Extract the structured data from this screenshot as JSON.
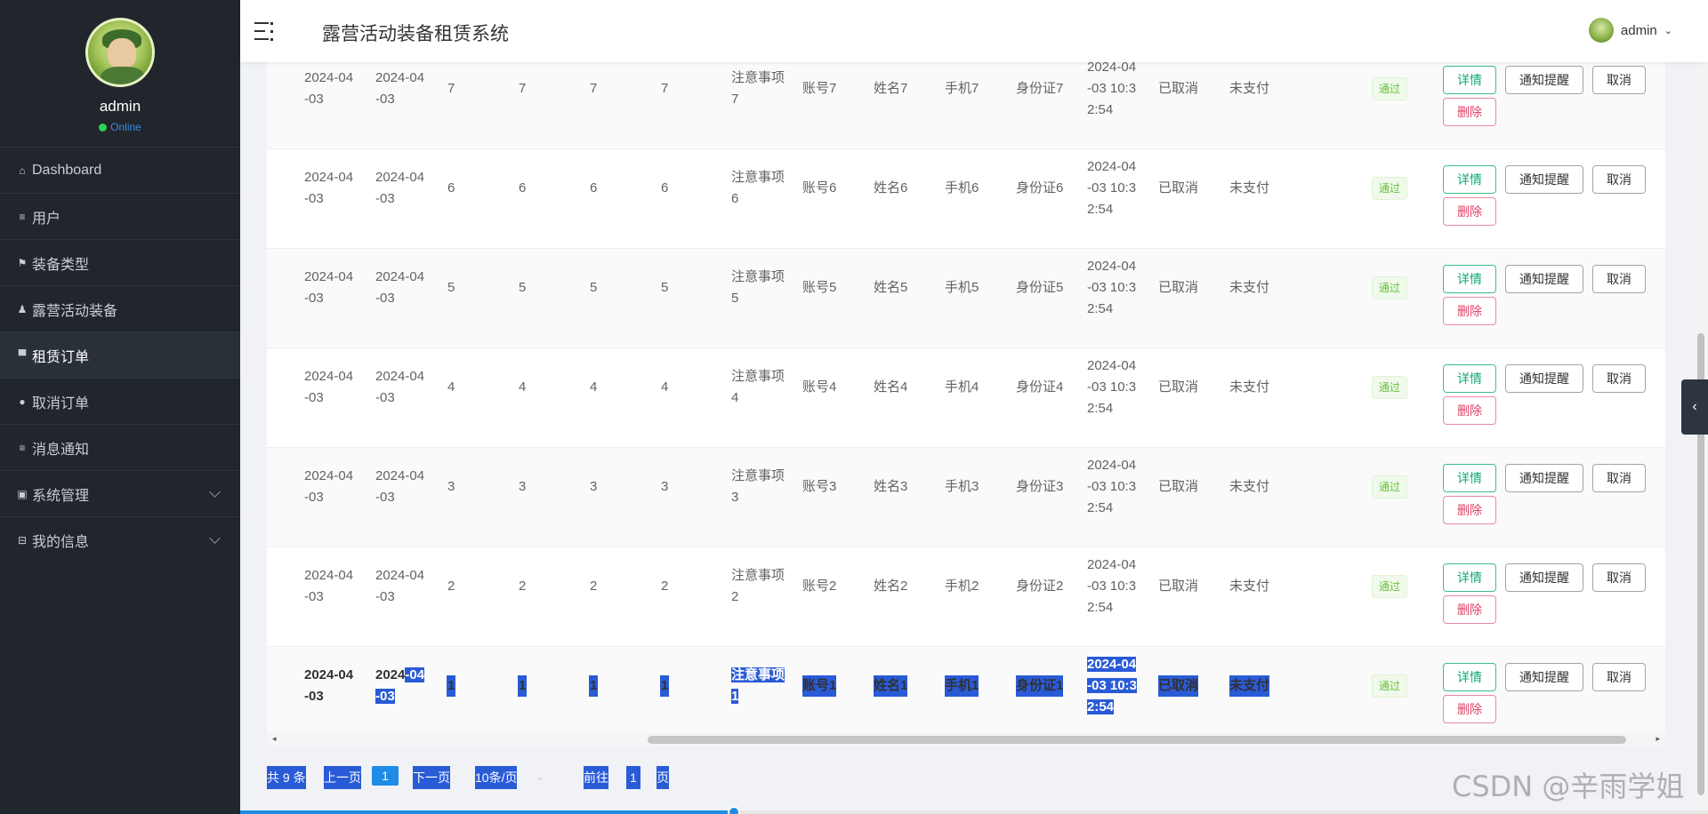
{
  "sidebar": {
    "username": "admin",
    "status": "Online",
    "items": [
      {
        "icon": "⌂",
        "label": "Dashboard"
      },
      {
        "icon": "≡",
        "label": "用户"
      },
      {
        "icon": "⚑",
        "label": "装备类型"
      },
      {
        "icon": "♟",
        "label": "露营活动装备"
      },
      {
        "icon": "▀",
        "label": "租赁订单",
        "active": true
      },
      {
        "icon": "●",
        "label": "取消订单"
      },
      {
        "icon": "≡",
        "label": "消息通知"
      },
      {
        "icon": "▣",
        "label": "系统管理",
        "expandable": true
      },
      {
        "icon": "⊟",
        "label": "我的信息",
        "expandable": true
      }
    ]
  },
  "header": {
    "title": "露营活动装备租赁系统",
    "user": "admin"
  },
  "table": {
    "rows": [
      {
        "start": "2024-04-03",
        "end": "2024-04-03",
        "c1": "7",
        "c2": "7",
        "c3": "7",
        "c4": "7",
        "notes": "注意事项7",
        "account": "账号7",
        "name": "姓名7",
        "phone": "手机7",
        "idcard": "身份证7",
        "time": "2024-04-03 10:32:54",
        "status": "已取消",
        "pay": "未支付",
        "review": "通过"
      },
      {
        "start": "2024-04-03",
        "end": "2024-04-03",
        "c1": "6",
        "c2": "6",
        "c3": "6",
        "c4": "6",
        "notes": "注意事项6",
        "account": "账号6",
        "name": "姓名6",
        "phone": "手机6",
        "idcard": "身份证6",
        "time": "2024-04-03 10:32:54",
        "status": "已取消",
        "pay": "未支付",
        "review": "通过"
      },
      {
        "start": "2024-04-03",
        "end": "2024-04-03",
        "c1": "5",
        "c2": "5",
        "c3": "5",
        "c4": "5",
        "notes": "注意事项5",
        "account": "账号5",
        "name": "姓名5",
        "phone": "手机5",
        "idcard": "身份证5",
        "time": "2024-04-03 10:32:54",
        "status": "已取消",
        "pay": "未支付",
        "review": "通过"
      },
      {
        "start": "2024-04-03",
        "end": "2024-04-03",
        "c1": "4",
        "c2": "4",
        "c3": "4",
        "c4": "4",
        "notes": "注意事项4",
        "account": "账号4",
        "name": "姓名4",
        "phone": "手机4",
        "idcard": "身份证4",
        "time": "2024-04-03 10:32:54",
        "status": "已取消",
        "pay": "未支付",
        "review": "通过"
      },
      {
        "start": "2024-04-03",
        "end": "2024-04-03",
        "c1": "3",
        "c2": "3",
        "c3": "3",
        "c4": "3",
        "notes": "注意事项3",
        "account": "账号3",
        "name": "姓名3",
        "phone": "手机3",
        "idcard": "身份证3",
        "time": "2024-04-03 10:32:54",
        "status": "已取消",
        "pay": "未支付",
        "review": "通过"
      },
      {
        "start": "2024-04-03",
        "end": "2024-04-03",
        "c1": "2",
        "c2": "2",
        "c3": "2",
        "c4": "2",
        "notes": "注意事项2",
        "account": "账号2",
        "name": "姓名2",
        "phone": "手机2",
        "idcard": "身份证2",
        "time": "2024-04-03 10:32:54",
        "status": "已取消",
        "pay": "未支付",
        "review": "通过"
      },
      {
        "start": "2024-04-03",
        "end": "2024-04-03",
        "c1": "1",
        "c2": "1",
        "c3": "1",
        "c4": "1",
        "notes": "注意事项1",
        "account": "账号1",
        "name": "姓名1",
        "phone": "手机1",
        "idcard": "身份证1",
        "time": "2024-04-03 10:32:54",
        "status": "已取消",
        "pay": "未支付",
        "review": "通过",
        "selected": true
      }
    ],
    "buttons": {
      "detail": "详情",
      "notify": "通知提醒",
      "cancel": "取消",
      "delete": "删除"
    }
  },
  "pagination": {
    "total": "共 9 条",
    "prev": "上一页",
    "current": "1",
    "next": "下一页",
    "page_size": "10条/页",
    "goto": "前往",
    "goto_value": "1",
    "page_suffix": "页"
  },
  "watermark": "CSDN @辛雨学姐",
  "colors": {
    "sidebar_bg": "#21262d",
    "accent": "#1e8ce6",
    "selection": "#2a5bd7",
    "tag_green": "#67c23a",
    "danger": "#e04267"
  }
}
